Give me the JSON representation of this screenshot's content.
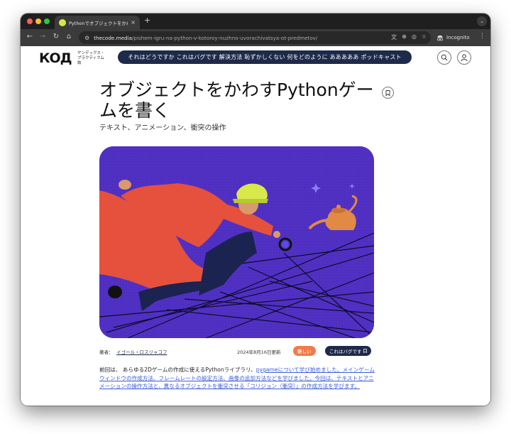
{
  "browser": {
    "tab_title": "Pythonでオブジェクトをかわす",
    "tab_close": "×",
    "new_tab": "+",
    "tab_menu": "⌄",
    "url_host": "thecode.media",
    "url_path": "/pishem-igru-na-python-v-kotoroy-nuzhno-uvorachivatsya-ot-predmetov/",
    "incognito_label": "Incognito",
    "nav_back": "←",
    "nav_forward": "→",
    "nav_reload": "↻",
    "nav_home": "⌂",
    "kebab": "⋮",
    "omni_icons": [
      "文",
      "⊕",
      "◎",
      "☆"
    ]
  },
  "site": {
    "logo": "КОД",
    "logo_sub": "ヤンデックス・プラクティクム 誌",
    "topics": "それはどうですか これはバグです 解決方法 恥ずかしくない 何をどのように あああああ ポッドキャスト"
  },
  "article": {
    "title": "オブジェクトをかわすPythonゲームを書く",
    "subtitle": "テキスト、アニメーション、衝突の操作",
    "author_label": "著者：",
    "author": "イゴール・ロスリャコフ",
    "date": "2024年8月16日更新",
    "badge_difficulty": "難しい",
    "badge_category": "これはバグです",
    "intro_1": "前回は、 あらゆる2Dゲームの作成に使えるPythonライブラリ、",
    "intro_link": "pygameについて学び始めました。メインゲームウィンドウの作成方法、フレームレートの設定方法、画像の追加方法などを学びました。今回は、テキストとアニメーションの操作方法と、異なるオブジェクトを衝突させる「コリジョン（衝突）」の作成方法を学びます。"
  },
  "colors": {
    "hero_bg": "#5131c4",
    "accent_orange": "#f07b4a",
    "navy": "#1e2a4a",
    "link": "#3b5bdb"
  },
  "icons": {
    "search": "search-icon",
    "user": "user-icon",
    "bookmark": "bookmark-icon"
  }
}
